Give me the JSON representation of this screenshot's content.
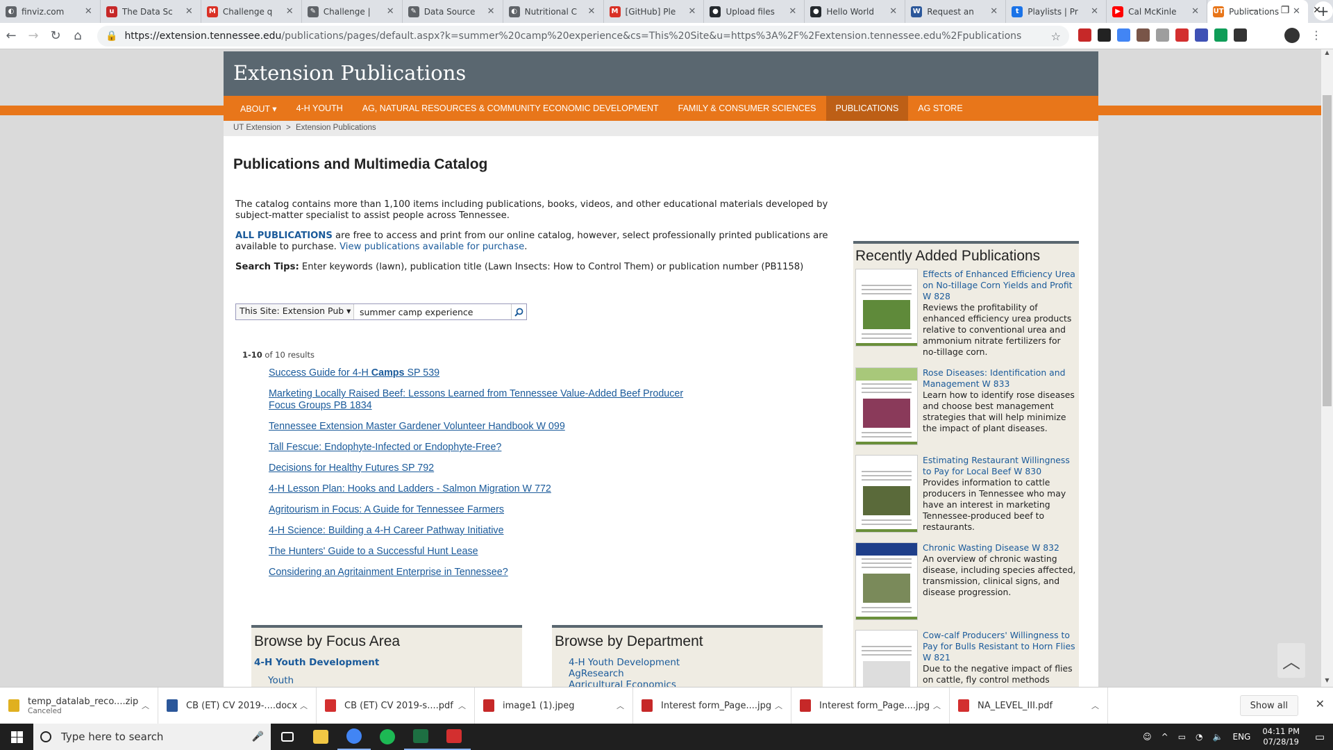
{
  "browser": {
    "tabs": [
      {
        "title": "finviz.com",
        "color": "#5f6368",
        "glyph": "◐"
      },
      {
        "title": "The Data Sc",
        "color": "#c62828",
        "glyph": "u"
      },
      {
        "title": "Challenge q",
        "color": "#d93025",
        "glyph": "M"
      },
      {
        "title": "Challenge |",
        "color": "#5f6368",
        "glyph": "✎"
      },
      {
        "title": "Data Source",
        "color": "#5f6368",
        "glyph": "✎"
      },
      {
        "title": "Nutritional C",
        "color": "#5f6368",
        "glyph": "◐"
      },
      {
        "title": "[GitHub] Ple",
        "color": "#d93025",
        "glyph": "M"
      },
      {
        "title": "Upload files",
        "color": "#24292e",
        "glyph": "●"
      },
      {
        "title": "Hello World",
        "color": "#24292e",
        "glyph": "●"
      },
      {
        "title": "Request an",
        "color": "#2b579a",
        "glyph": "W"
      },
      {
        "title": "Playlists | Pr",
        "color": "#1a73e8",
        "glyph": "t"
      },
      {
        "title": "Cal McKinle",
        "color": "#ff0000",
        "glyph": "▶"
      },
      {
        "title": "Publications",
        "color": "#e8761a",
        "glyph": "UT",
        "active": true
      }
    ],
    "url_host": "https://extension.tennessee.edu",
    "url_path": "/publications/pages/default.aspx?k=summer%20camp%20experience&cs=This%20Site&u=https%3A%2F%2Fextension.tennessee.edu%2Fpublications",
    "extension_colors": [
      "#c62828",
      "#222222",
      "#4285f4",
      "#795548",
      "#9e9e9e",
      "#d32f2f",
      "#3f51b5",
      "#0f9d58",
      "#333333"
    ]
  },
  "site": {
    "header_title": "Extension Publications",
    "nav": [
      {
        "label": "ABOUT ▾"
      },
      {
        "label": "4-H YOUTH"
      },
      {
        "label": "AG, NATURAL RESOURCES & COMMUNITY ECONOMIC DEVELOPMENT"
      },
      {
        "label": "FAMILY & CONSUMER SCIENCES"
      },
      {
        "label": "PUBLICATIONS",
        "active": true
      },
      {
        "label": "AG STORE"
      }
    ],
    "breadcrumb": {
      "root": "UT Extension",
      "sep": ">",
      "current": "Extension Publications"
    }
  },
  "main": {
    "page_title": "Publications and Multimedia Catalog",
    "intro_1": "The catalog contains more than 1,100 items including publications, books, videos, and other educational materials developed by subject-matter specialist to assist people across Tennessee.",
    "intro_2_strong": "ALL PUBLICATIONS",
    "intro_2_text": " are free to access and print from our online catalog, however, select professionally printed publications are available to purchase. ",
    "intro_2_link": "View publications available for purchase",
    "intro_2_end": ".",
    "tips_label": "Search Tips:",
    "tips_text": " Enter keywords (lawn), publication title (Lawn Insects: How to Control Them) or publication number (PB1158)"
  },
  "search": {
    "scope": "This Site: Extension Pub ▾",
    "value": "summer camp experience"
  },
  "results": {
    "range": "1-10",
    "of_text": " of 10 results",
    "items": [
      {
        "pre": "Success Guide for 4-H ",
        "bold": "Camps",
        "post": " SP 539"
      },
      {
        "pre": "Marketing Locally Raised Beef: Lessons Learned from Tennessee Value-Added Beef Producer Focus Groups PB 1834",
        "bold": "",
        "post": ""
      },
      {
        "pre": "Tennessee Extension Master Gardener Volunteer Handbook W 099",
        "bold": "",
        "post": ""
      },
      {
        "pre": "Tall Fescue: Endophyte-Infected or Endophyte-Free?",
        "bold": "",
        "post": ""
      },
      {
        "pre": "Decisions for Healthy Futures SP 792",
        "bold": "",
        "post": ""
      },
      {
        "pre": "4-H Lesson Plan: Hooks and Ladders - Salmon Migration W 772",
        "bold": "",
        "post": ""
      },
      {
        "pre": "Agritourism in Focus: A Guide for Tennessee Farmers",
        "bold": "",
        "post": ""
      },
      {
        "pre": "4-H Science: Building a 4-H Career Pathway Initiative",
        "bold": "",
        "post": ""
      },
      {
        "pre": "The Hunters' Guide to a Successful Hunt Lease",
        "bold": "",
        "post": ""
      },
      {
        "pre": "Considering an Agritainment Enterprise in Tennessee?",
        "bold": "",
        "post": ""
      }
    ]
  },
  "browse_focus": {
    "title": "Browse by Focus Area",
    "item": "4-H Youth Development",
    "sub": "Youth"
  },
  "browse_dept": {
    "title": "Browse by Department",
    "items": [
      "4-H Youth Development",
      "AgResearch",
      "Agricultural Economics"
    ]
  },
  "recent": {
    "title": "Recently Added Publications",
    "items": [
      {
        "title": "Effects of Enhanced Efficiency Urea on No-tillage Corn Yields and Profit W 828",
        "desc": "Reviews the profitability of enhanced efficiency urea products relative to conventional urea and ammonium nitrate fertilizers for no-tillage corn.",
        "pic": "#5f8a3a",
        "band": "#ffffff"
      },
      {
        "title": "Rose Diseases: Identification and Management W 833",
        "desc": "Learn how to identify rose diseases and choose best management strategies that will help minimize the impact of plant diseases.",
        "pic": "#8a3a5a",
        "band": "#a8c87a"
      },
      {
        "title": "Estimating Restaurant Willingness to Pay for Local Beef W 830",
        "desc": "Provides information to cattle producers in Tennessee who may have an interest in marketing Tennessee-produced beef to restaurants.",
        "pic": "#5a6a3a",
        "band": "#ffffff"
      },
      {
        "title": "Chronic Wasting Disease W 832",
        "desc": "An overview of chronic wasting disease, including species affected, transmission, clinical signs, and disease progression.",
        "pic": "#7a8a5a",
        "band": "#1f3f8a"
      },
      {
        "title": "Cow-calf Producers' Willingness to Pay for Bulls Resistant to Horn Flies W 821",
        "desc": "Due to the negative impact of flies on cattle, fly control methods garner significant attention each year. Learn about the results of a survey to determine producers' willingness to pay a premium for horn fly-resistant bulls.",
        "pic": "#dddddd",
        "band": "#ffffff"
      }
    ]
  },
  "downloads": {
    "items": [
      {
        "name": "temp_datalab_reco....zip",
        "sub": "Canceled",
        "color": "#e0b020"
      },
      {
        "name": "CB (ET) CV 2019-....docx",
        "sub": "",
        "color": "#2b579a"
      },
      {
        "name": "CB (ET) CV 2019-s....pdf",
        "sub": "",
        "color": "#d32f2f"
      },
      {
        "name": "image1 (1).jpeg",
        "sub": "",
        "color": "#c62828"
      },
      {
        "name": "Interest form_Page....jpg",
        "sub": "",
        "color": "#c62828"
      },
      {
        "name": "Interest form_Page....jpg",
        "sub": "",
        "color": "#c62828"
      },
      {
        "name": "NA_LEVEL_III.pdf",
        "sub": "",
        "color": "#d32f2f"
      }
    ],
    "show_all": "Show all"
  },
  "taskbar": {
    "search_placeholder": "Type here to search",
    "apps": [
      {
        "name": "task-view",
        "color": "#1f1f1f"
      },
      {
        "name": "file-explorer",
        "color": "#f2c744"
      },
      {
        "name": "chrome",
        "color": "#4285f4",
        "running": true
      },
      {
        "name": "spotify",
        "color": "#1db954"
      },
      {
        "name": "excel",
        "color": "#1d6f42",
        "running": true
      },
      {
        "name": "acrobat",
        "color": "#d32f2f",
        "running": true
      }
    ],
    "lang": "ENG",
    "time": "04:11 PM",
    "date": "07/28/19"
  }
}
